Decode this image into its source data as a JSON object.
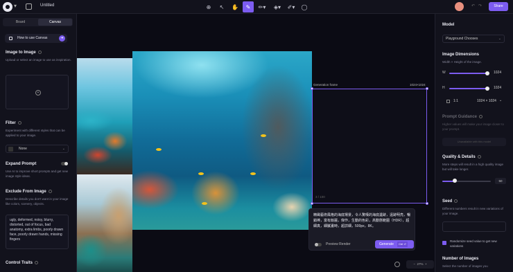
{
  "topbar": {
    "title": "Untitled",
    "share_label": "Share",
    "tools": [
      "add-image-icon",
      "select-icon",
      "hand-icon",
      "edit-image-icon",
      "brush-icon",
      "fill-icon",
      "pencil-icon",
      "comment-icon"
    ]
  },
  "left_panel": {
    "tabs": [
      "Board",
      "Canvas"
    ],
    "active_tab": "Canvas",
    "how_to_label": "How to use Canvas",
    "image_to_image": {
      "title": "Image to Image",
      "desc": "Upload or select an image to use as inspiration."
    },
    "filter": {
      "title": "Filter",
      "desc": "Experiment with different styles that can be applied to your image.",
      "value": "None"
    },
    "expand_prompt": {
      "title": "Expand Prompt",
      "desc": "Use AI to improve short prompts and get new image style ideas."
    },
    "exclude": {
      "title": "Exclude From Image",
      "desc": "Describe details you don't want in your image like colors, scenery, objects.",
      "value": "ugly, deformed, noisy, blurry, distorted, out of focus, bad anatomy, extra limbs, poorly drawn face, poorly drawn hands, missing fingers"
    },
    "control_traits": {
      "title": "Control Traits"
    }
  },
  "canvas": {
    "frame_label": "Generation frame",
    "frame_size": "1024×1024",
    "counter": "3 / 100",
    "prompt_text": "精緻藝術風格的海底場景，令人驚嘆的海底遺跡，遠跡明亮，暢銷棒，富有飯麗，傑作，生動的色彩，高動態範圍（HDR），超細真，細膩畫時，超詳細，500px，8K。",
    "preview_label": "Preview Render",
    "generate_label": "Generate",
    "generate_shortcut": "Ctrl ⏎",
    "zoom": "27%"
  },
  "right_panel": {
    "model": {
      "title": "Model",
      "value": "Playground Chooses"
    },
    "dimensions": {
      "title": "Image Dimensions",
      "desc": "Width × Height of the image.",
      "width_label": "W",
      "width_value": "1024",
      "height_label": "H",
      "height_value": "1024",
      "ratio": "1:1",
      "ratio_value": "1024 × 1024"
    },
    "prompt_guidance": {
      "title": "Prompt Guidance",
      "desc": "Higher values will make your image closer to your prompt.",
      "disabled_label": "Unavailable with this model"
    },
    "quality": {
      "title": "Quality & Details",
      "desc": "More steps will result in a high quality image but will take longer.",
      "value": "50",
      "fraction": 0.26
    },
    "seed": {
      "title": "Seed",
      "desc": "Different numbers result in new variations of your image."
    },
    "randomize_label": "Randomize seed value to get new variations",
    "num_images": {
      "title": "Number of Images",
      "desc": "Select the number of images you"
    }
  },
  "colors": {
    "accent": "#7c5cf0",
    "background": "#0d0d17",
    "panel": "#12121c"
  }
}
